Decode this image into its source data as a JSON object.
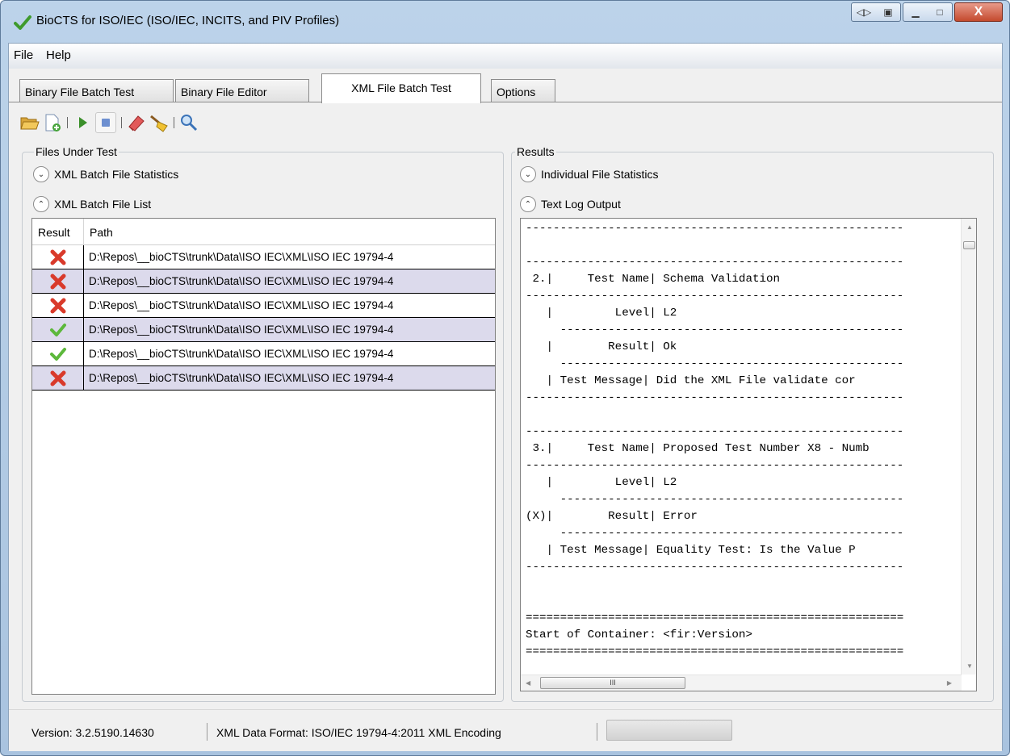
{
  "window": {
    "title": "BioCTS for ISO/IEC (ISO/IEC, INCITS, and PIV Profiles)",
    "caption_buttons": [
      "restore-code",
      "copy",
      "minimize",
      "maximize",
      "close"
    ]
  },
  "menu": {
    "items": [
      "File",
      "Help"
    ]
  },
  "tabs": [
    {
      "label": "Binary File Batch Test",
      "active": false
    },
    {
      "label": "Binary File Editor",
      "active": false
    },
    {
      "label": "XML File Batch Test",
      "active": true
    },
    {
      "label": "Options",
      "active": false
    }
  ],
  "toolbar": {
    "icons": [
      "open-folder-icon",
      "add-file-icon",
      "play-icon",
      "stop-icon",
      "eraser-icon",
      "broom-icon",
      "magnifier-icon"
    ]
  },
  "left_panel": {
    "group_label": "Files Under Test",
    "stats_expander": "XML Batch File Statistics",
    "list_expander": "XML Batch File List",
    "columns": [
      "Result",
      "Path"
    ],
    "rows": [
      {
        "result": "fail",
        "path": "D:\\Repos\\__bioCTS\\trunk\\Data\\ISO IEC\\XML\\ISO IEC 19794-4"
      },
      {
        "result": "fail",
        "path": "D:\\Repos\\__bioCTS\\trunk\\Data\\ISO IEC\\XML\\ISO IEC 19794-4"
      },
      {
        "result": "fail",
        "path": "D:\\Repos\\__bioCTS\\trunk\\Data\\ISO IEC\\XML\\ISO IEC 19794-4"
      },
      {
        "result": "pass",
        "path": "D:\\Repos\\__bioCTS\\trunk\\Data\\ISO IEC\\XML\\ISO IEC 19794-4"
      },
      {
        "result": "pass",
        "path": "D:\\Repos\\__bioCTS\\trunk\\Data\\ISO IEC\\XML\\ISO IEC 19794-4"
      },
      {
        "result": "fail",
        "path": "D:\\Repos\\__bioCTS\\trunk\\Data\\ISO IEC\\XML\\ISO IEC 19794-4"
      }
    ]
  },
  "right_panel": {
    "group_label": "Results",
    "stats_expander": "Individual File Statistics",
    "log_expander": "Text Log Output",
    "log_lines": [
      "-------------------------------------------------------",
      "",
      "-------------------------------------------------------",
      " 2.|     Test Name| Schema Validation",
      "-------------------------------------------------------",
      "   |         Level| L2",
      "     --------------------------------------------------",
      "   |        Result| Ok",
      "     --------------------------------------------------",
      "   | Test Message| Did the XML File validate cor",
      "-------------------------------------------------------",
      "",
      "-------------------------------------------------------",
      " 3.|     Test Name| Proposed Test Number X8 - Numb",
      "-------------------------------------------------------",
      "   |         Level| L2",
      "     --------------------------------------------------",
      "(X)|        Result| Error",
      "     --------------------------------------------------",
      "   | Test Message| Equality Test: Is the Value P",
      "-------------------------------------------------------",
      "",
      "",
      "=======================================================",
      "Start of Container: <fir:Version>",
      "======================================================="
    ],
    "hscroll_grip": "III"
  },
  "status": {
    "version": "Version: 3.2.5190.14630",
    "format": "XML Data Format: ISO/IEC 19794-4:2011 XML Encoding"
  }
}
